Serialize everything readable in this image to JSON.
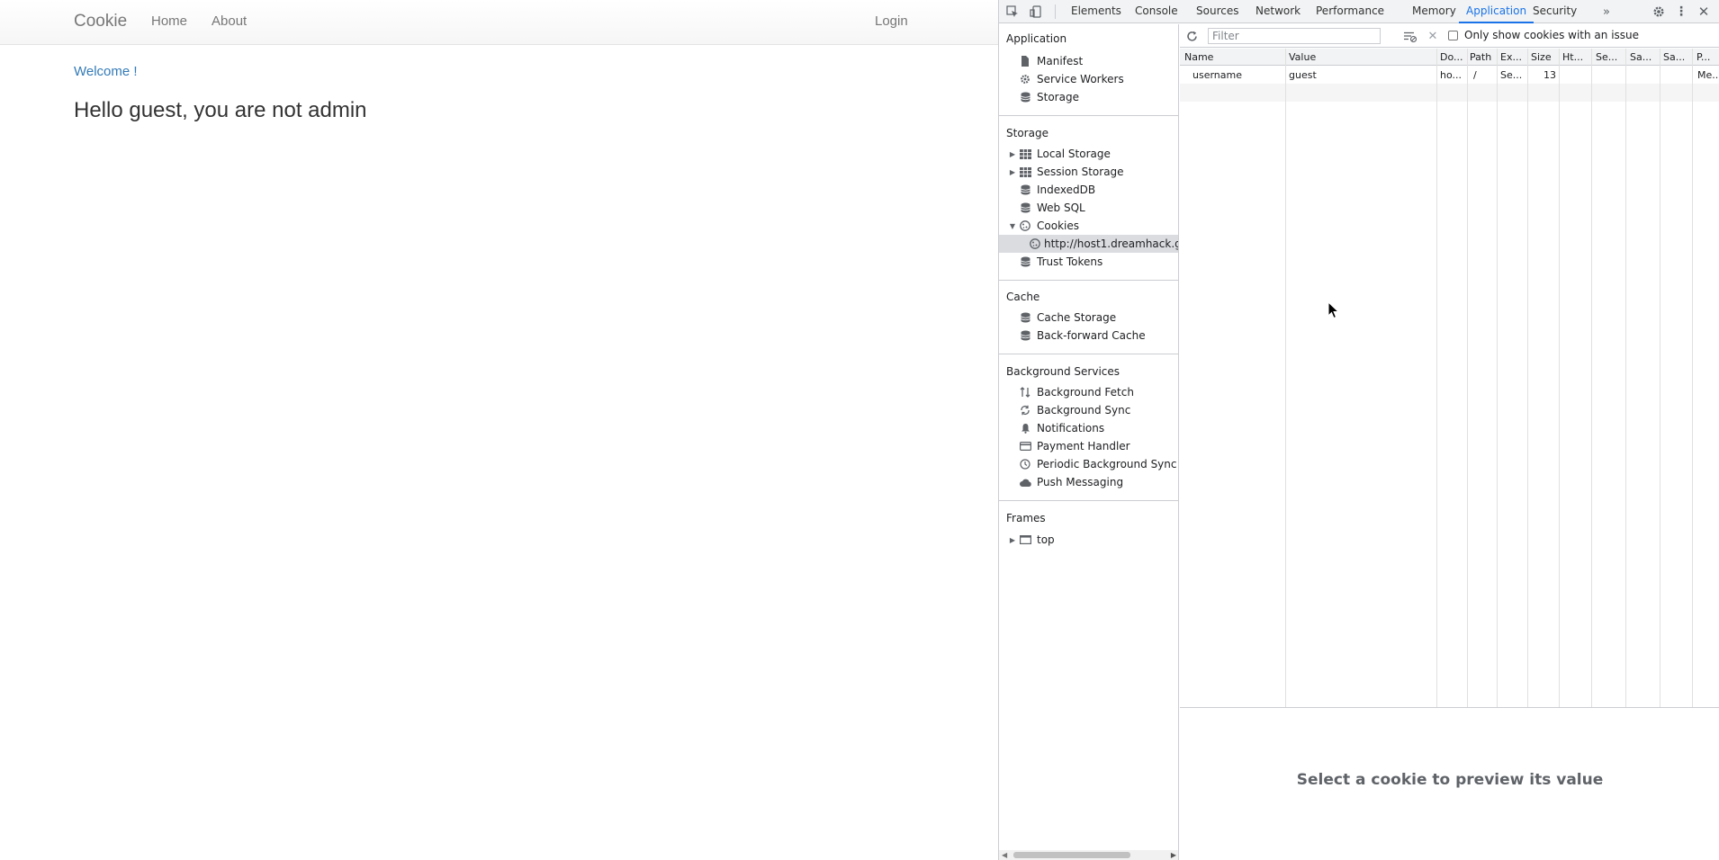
{
  "page": {
    "brand": "Cookie",
    "nav": {
      "home": "Home",
      "about": "About",
      "login": "Login"
    },
    "welcome": "Welcome !",
    "message": "Hello guest, you are not admin"
  },
  "devtools": {
    "tabs": [
      "Elements",
      "Console",
      "Sources",
      "Network",
      "Performance",
      "Memory",
      "Application",
      "Security"
    ],
    "active_tab": "Application",
    "sidebar": {
      "application": {
        "title": "Application",
        "items": [
          "Manifest",
          "Service Workers",
          "Storage"
        ]
      },
      "storage": {
        "title": "Storage",
        "items": [
          "Local Storage",
          "Session Storage",
          "IndexedDB",
          "Web SQL",
          "Cookies"
        ],
        "cookie_origin": "http://host1.dreamhack.games:",
        "trust_tokens": "Trust Tokens"
      },
      "cache": {
        "title": "Cache",
        "items": [
          "Cache Storage",
          "Back-forward Cache"
        ]
      },
      "background": {
        "title": "Background Services",
        "items": [
          "Background Fetch",
          "Background Sync",
          "Notifications",
          "Payment Handler",
          "Periodic Background Sync",
          "Push Messaging"
        ]
      },
      "frames": {
        "title": "Frames",
        "items": [
          "top"
        ]
      }
    },
    "toolbar": {
      "filter_placeholder": "Filter",
      "only_issues_label": "Only show cookies with an issue",
      "only_issues_checked": false
    },
    "table": {
      "columns": [
        "Name",
        "Value",
        "Do...",
        "Path",
        "Ex...",
        "Size",
        "Ht...",
        "Se...",
        "Sa...",
        "Sa...",
        "P..."
      ],
      "rows": [
        [
          "username",
          "guest",
          "ho...",
          "/",
          "Se...",
          "13",
          "",
          "",
          "",
          "",
          "Me..."
        ]
      ]
    },
    "preview_text": "Select a cookie to preview its value"
  }
}
